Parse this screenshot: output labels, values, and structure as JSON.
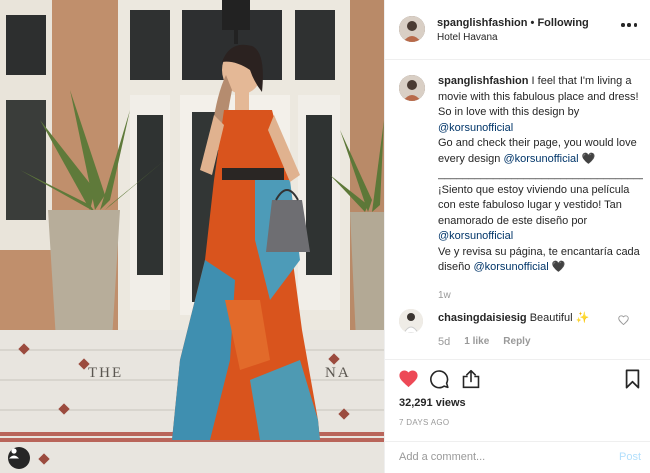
{
  "post": {
    "username": "spanglishfashion",
    "dot": "•",
    "follow_status": "Following",
    "location": "Hotel Havana"
  },
  "caption": {
    "username": "spanglishfashion",
    "line1": "I feel that I'm living a movie with this fabulous place and dress! So in love with this design by",
    "mention1": "@korsunofficial",
    "line2": "Go and check their page, you would love every design",
    "mention2": "@korsunofficial",
    "heart1": "🖤",
    "divider": "________________________________________",
    "line3": "¡Siento que estoy viviendo una película con este fabuloso lugar y vestido! Tan enamorado de este diseño por",
    "mention3": "@korsunofficial",
    "line4": "Ve y revisa su página, te encantaría cada diseño",
    "mention4": "@korsunofficial",
    "heart2": "🖤",
    "time": "1w"
  },
  "reply": {
    "username": "chasingdaisiesig",
    "text": "Beautiful",
    "emoji": "✨",
    "time": "5d",
    "likes": "1 like",
    "reply_label": "Reply"
  },
  "stats": {
    "views": "32,291 views",
    "date": "7 DAYS AGO"
  },
  "add_comment": {
    "placeholder": "Add a comment...",
    "post_label": "Post"
  },
  "media": {
    "sign_left": "THE",
    "sign_right": "NA"
  },
  "colors": {
    "like_red": "#ed4956",
    "link_blue": "#003569",
    "post_disabled": "#b2dffc",
    "muted": "#999999"
  },
  "icons": [
    "user-tag-icon",
    "more-options-icon",
    "heart-icon",
    "comment-icon",
    "share-icon",
    "bookmark-icon"
  ]
}
